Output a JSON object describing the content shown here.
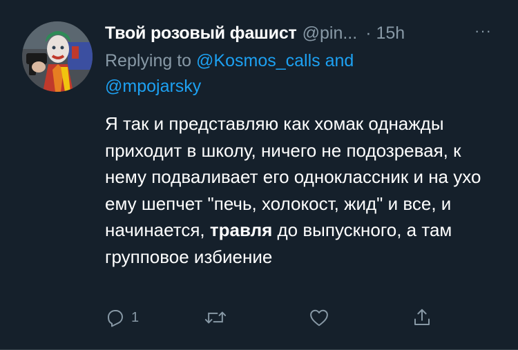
{
  "tweet": {
    "display_name": "Твой розовый фашист",
    "handle": "@pin...",
    "time": "· 15h",
    "more_label": "···",
    "replying_to_prefix": "Replying to",
    "mention_1": "@Kosmos_calls",
    "replying_and": "and",
    "mention_2": "@mpojarsky",
    "text_part1": "Я так и представляю как хомак однажды приходит в школу, ничего не подозревая, к нему подваливает его одноклассник и на ухо ему шепчет \"печь, холокост, жид\" и все, и начинается, ",
    "text_bold": "травля",
    "text_part2": " до выпускного, а там групповое избиение",
    "reply_count": "1"
  },
  "icons": {
    "reply": "speech-bubble-icon",
    "retweet": "retweet-icon",
    "like": "heart-icon",
    "share": "share-icon",
    "more": "ellipsis-icon"
  },
  "colors": {
    "background": "#15202b",
    "secondary_text": "#8899a6",
    "link": "#1da1f2"
  }
}
